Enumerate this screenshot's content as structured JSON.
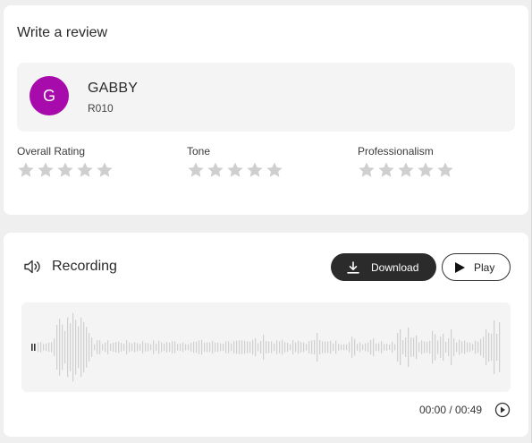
{
  "review": {
    "title": "Write a review",
    "reviewee": {
      "initial": "G",
      "name": "GABBY",
      "id": "R010",
      "avatar_color": "#a80bab"
    },
    "ratings": [
      {
        "label": "Overall Rating",
        "value": 0,
        "max": 5
      },
      {
        "label": "Tone",
        "value": 0,
        "max": 5
      },
      {
        "label": "Professionalism",
        "value": 0,
        "max": 5
      }
    ],
    "star_color": "#cfcfcf"
  },
  "recording": {
    "icon": "speaker-icon",
    "title": "Recording",
    "download_label": "Download",
    "play_label": "Play",
    "current_time": "00:00",
    "duration": "00:49",
    "separator": " / ",
    "progress": 0
  },
  "colors": {
    "dark_button": "#2b2b2b",
    "waveform_bar": "#d0d0d0",
    "waveform_bg": "#f4f4f4"
  }
}
